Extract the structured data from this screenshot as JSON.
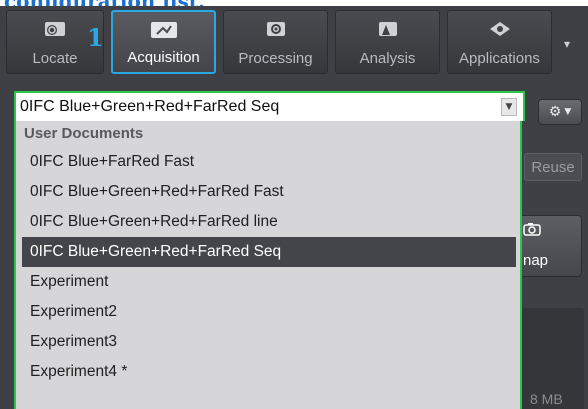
{
  "caption": "configuration list.",
  "step_number": "1",
  "toolbar": {
    "tabs": [
      {
        "label": "Locate",
        "icon": "locate-icon"
      },
      {
        "label": "Acquisition",
        "icon": "acquisition-icon",
        "active": true
      },
      {
        "label": "Processing",
        "icon": "processing-icon"
      },
      {
        "label": "Analysis",
        "icon": "analysis-icon"
      },
      {
        "label": "Applications",
        "icon": "applications-icon"
      }
    ]
  },
  "experiment_combo": {
    "value": "0IFC Blue+Green+Red+FarRed Seq"
  },
  "dropdown": {
    "header": "User Documents",
    "items": [
      "0IFC Blue+FarRed Fast",
      "0IFC Blue+Green+Red+FarRed Fast",
      "0IFC Blue+Green+Red+FarRed line",
      "0IFC Blue+Green+Red+FarRed Seq",
      "Experiment",
      "Experiment2",
      "Experiment3",
      "Experiment4 *"
    ],
    "selected_index": 3
  },
  "side": {
    "reuse_label": "Reuse",
    "snap_label": "nap",
    "size_label": "8 MB"
  },
  "colors": {
    "accent": "#29a8e3",
    "highlight_border": "#2bc74a",
    "caption": "#1a6fd0"
  }
}
